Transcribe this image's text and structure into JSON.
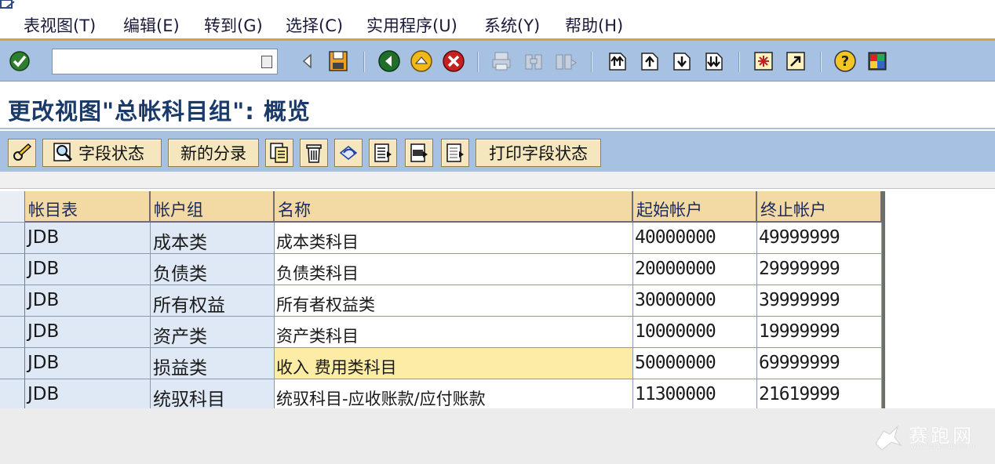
{
  "menu": {
    "items": [
      {
        "label": "表视图(T)"
      },
      {
        "label": "编辑(E)"
      },
      {
        "label": "转到(G)"
      },
      {
        "label": "选择(C)"
      },
      {
        "label": "实用程序(U)"
      },
      {
        "label": "系统(Y)"
      },
      {
        "label": "帮助(H)"
      }
    ]
  },
  "command_field": {
    "value": ""
  },
  "page": {
    "title": "更改视图\"总帐科目组\": 概览"
  },
  "app_toolbar": {
    "field_status_label": "字段状态",
    "new_entries_label": "新的分录",
    "print_field_status_label": "打印字段状态"
  },
  "table": {
    "headers": [
      "帐目表",
      "帐户组",
      "名称",
      "起始帐户",
      "终止帐户"
    ],
    "rows": [
      {
        "chart": "JDB",
        "group": "成本类",
        "name": "成本类科目",
        "from": "40000000",
        "to": "49999999"
      },
      {
        "chart": "JDB",
        "group": "负债类",
        "name": "负债类科目",
        "from": "20000000",
        "to": "29999999"
      },
      {
        "chart": "JDB",
        "group": "所有权益",
        "name": "所有者权益类",
        "from": "30000000",
        "to": "39999999"
      },
      {
        "chart": "JDB",
        "group": "资产类",
        "name": "资产类科目",
        "from": "10000000",
        "to": "19999999"
      },
      {
        "chart": "JDB",
        "group": "损益类",
        "name": "收入 费用类科目",
        "from": "50000000",
        "to": "69999999"
      },
      {
        "chart": "JDB",
        "group": "统驭科目",
        "name": "统驭科目-应收账款/应付账款",
        "from": "11300000",
        "to": "21619999"
      }
    ]
  },
  "watermark": {
    "text": "赛跑网",
    "url": "www.91sap.com"
  },
  "colors": {
    "toolbar_bg": "#a6c1e2",
    "header_bg": "#f3d9a4",
    "highlight_cell": "#fdeca5",
    "accent_line": "#e59a3c",
    "title_text": "#1a3a6a"
  }
}
